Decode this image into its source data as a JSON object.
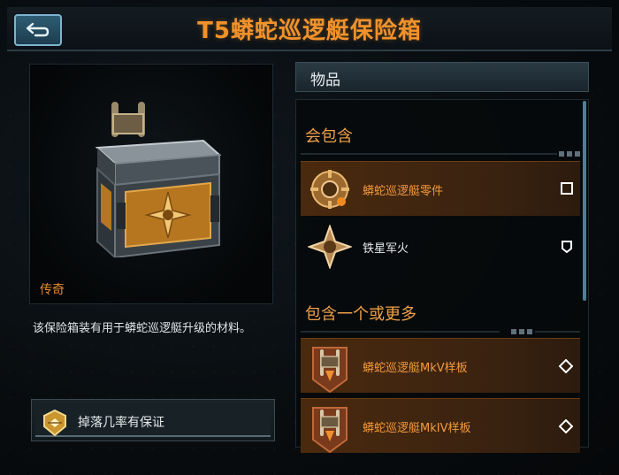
{
  "header": {
    "title": "T5蟒蛇巡逻艇保险箱"
  },
  "item": {
    "rarity": "传奇",
    "description": "该保险箱装有用于蟒蛇巡逻艇升级的材料。",
    "guarantee_label": "掉落几率有保证"
  },
  "panel": {
    "title": "物品",
    "sections": [
      {
        "title": "会包含",
        "items": [
          {
            "label": "蟒蛇巡逻艇零件",
            "highlighted": true,
            "marker": "square-marker-icon"
          },
          {
            "label": "铁星军火",
            "highlighted": false,
            "marker": "shield-marker-icon"
          }
        ]
      },
      {
        "title": "包含一个或更多",
        "items": [
          {
            "label": "蟒蛇巡逻艇MkV样板",
            "highlighted": true,
            "marker": "diamond-marker-icon"
          },
          {
            "label": "蟒蛇巡逻艇MkIV样板",
            "highlighted": true,
            "marker": "diamond-marker-icon"
          }
        ]
      }
    ]
  },
  "colors": {
    "accent": "#f0922b",
    "highlight_row": "#4a2a0e",
    "back_button": "#2f5c73"
  }
}
